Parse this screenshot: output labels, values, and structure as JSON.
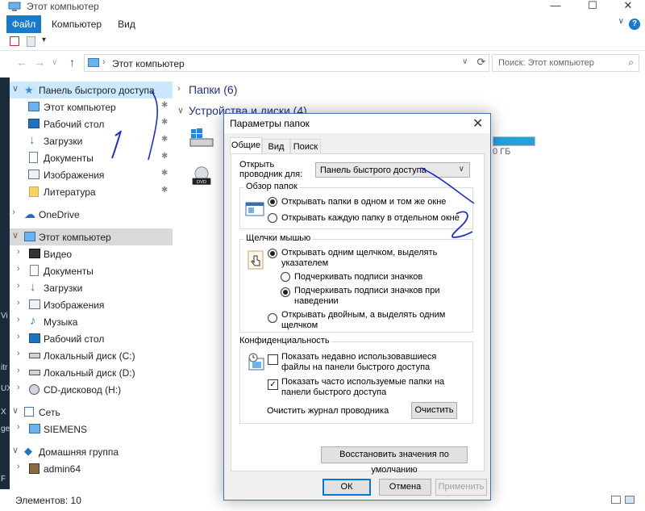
{
  "window": {
    "title": "Этот компьютер",
    "controls": {
      "minimize": "—",
      "maximize": "☐",
      "close": "✕"
    }
  },
  "ribbon": {
    "tabs": [
      "Файл",
      "Компьютер",
      "Вид"
    ],
    "help": "?",
    "expand": "∨"
  },
  "address": {
    "sep": "›",
    "path": "Этот компьютер",
    "dropdown": "∨",
    "refresh": "⟳",
    "search_placeholder": "Поиск: Этот компьютер",
    "search_icon": "⌕"
  },
  "nav": {
    "back": "←",
    "forward": "→",
    "recent": "∨",
    "up": "↑"
  },
  "navpane": {
    "quick_access": "Панель быстрого доступа",
    "quick_items": [
      "Этот компьютер",
      "Рабочий стол",
      "Загрузки",
      "Документы",
      "Изображения",
      "Литература"
    ],
    "onedrive": "OneDrive",
    "this_pc": "Этот компьютер",
    "pc_items": [
      "Видео",
      "Документы",
      "Загрузки",
      "Изображения",
      "Музыка",
      "Рабочий стол",
      "Локальный диск (C:)",
      "Локальный диск (D:)",
      "CD-дисковод (H:)"
    ],
    "network": "Сеть",
    "network_items": [
      "SIEMENS"
    ],
    "homegroup": "Домашняя группа",
    "homegroup_items": [
      "admin64"
    ]
  },
  "content": {
    "group_folders": "Папки (6)",
    "group_devices": "Устройства и диски (4)",
    "drive_size_text": "0 ГБ",
    "dvd_label": "DVD",
    "drive_fill": 1.0
  },
  "status": {
    "items": "Элементов: 10"
  },
  "dialog": {
    "title": "Параметры папок",
    "close": "✕",
    "tabs": [
      "Общие",
      "Вид",
      "Поиск"
    ],
    "open_explorer_label": "Открыть проводник для:",
    "open_explorer_value": "Панель быстрого доступа",
    "browse_group": "Обзор папок",
    "browse_opt1": "Открывать папки в одном и том же окне",
    "browse_opt2": "Открывать каждую папку в отдельном окне",
    "click_group": "Щелчки мышью",
    "click_opt1": "Открывать одним щелчком, выделять указателем",
    "click_sub1": "Подчеркивать подписи значков",
    "click_sub2": "Подчеркивать подписи значков при наведении",
    "click_opt2": "Открывать двойным, а выделять одним щелчком",
    "privacy_group": "Конфиденциальность",
    "privacy_chk1": "Показать недавно использовавшиеся файлы на панели быстрого доступа",
    "privacy_chk2": "Показать часто используемые папки на панели быстрого доступа",
    "clear_label": "Очистить журнал проводника",
    "clear_btn": "Очистить",
    "restore_btn": "Восстановить значения по умолчанию",
    "ok": "ОК",
    "cancel": "Отмена",
    "apply": "Применить"
  },
  "annotations": {
    "mark1": "1",
    "mark2": "2",
    "ink_color": "#1a2fd0"
  },
  "desktop_edge": [
    "Vi",
    "itr",
    "X",
    "UX",
    "ge",
    "F"
  ]
}
